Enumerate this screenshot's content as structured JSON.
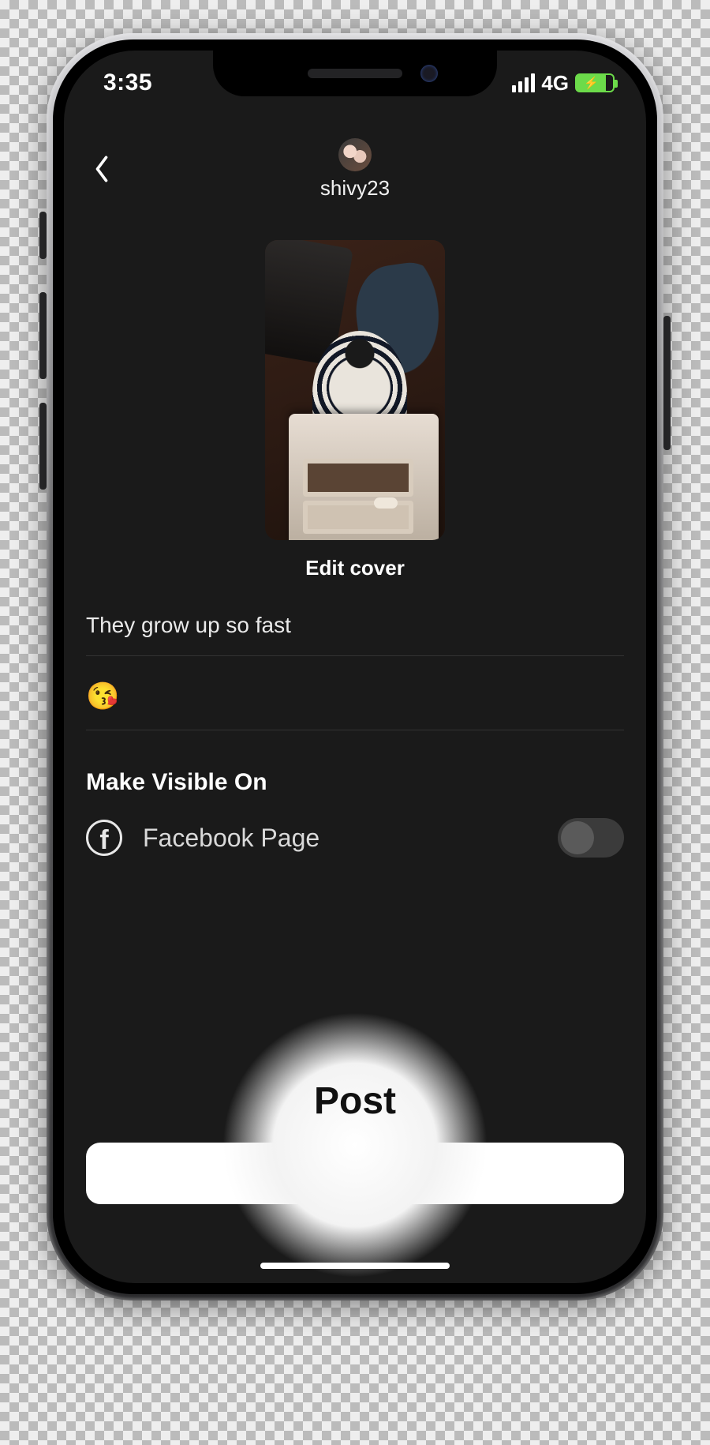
{
  "status_bar": {
    "time": "3:35",
    "network_label": "4G"
  },
  "header": {
    "username": "shivy23"
  },
  "cover": {
    "edit_label": "Edit cover"
  },
  "caption": {
    "text": "They grow up so fast",
    "emoji": "😘"
  },
  "visibility": {
    "heading": "Make Visible On",
    "options": [
      {
        "icon": "facebook-icon",
        "label": "Facebook Page",
        "enabled": false
      }
    ]
  },
  "post_button": {
    "label": "Post"
  }
}
